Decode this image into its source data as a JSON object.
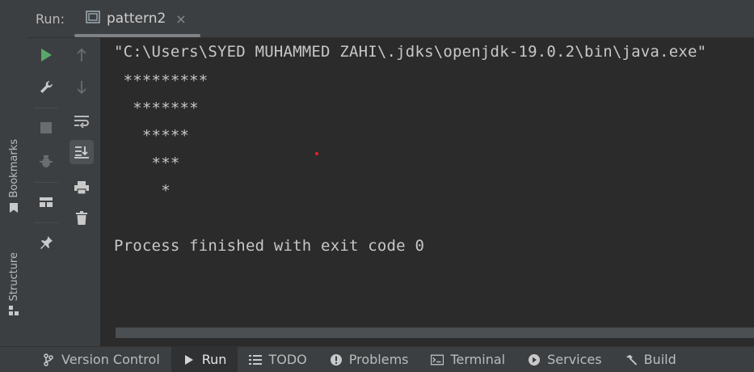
{
  "side_strip": {
    "bookmarks_label": "Bookmarks",
    "structure_label": "Structure"
  },
  "header": {
    "run_label": "Run:",
    "tab_label": "pattern2",
    "tab_close": "×"
  },
  "console": {
    "lines": [
      "\"C:\\Users\\SYED MUHAMMED ZAHI\\.jdks\\openjdk-19.0.2\\bin\\java.exe\"",
      " *********",
      "  *******",
      "   *****",
      "    ***",
      "     *",
      "",
      "Process finished with exit code 0"
    ]
  },
  "bottom_bar": {
    "items": [
      "Version Control",
      "Run",
      "TODO",
      "Problems",
      "Terminal",
      "Services",
      "Build"
    ]
  },
  "colors": {
    "run_green": "#59a869",
    "background": "#2b2b2b",
    "panel": "#3c3f41"
  }
}
